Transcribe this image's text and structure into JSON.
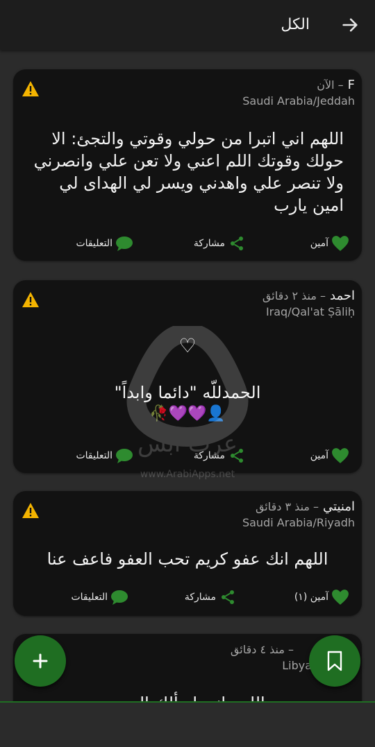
{
  "appbar": {
    "title": "الكل",
    "back_icon": "arrow-right-icon"
  },
  "posts": [
    {
      "author": "F",
      "time": "– الآن",
      "location": "Saudi Arabia/Jeddah",
      "text": "اللهم اني اتبرا من حولي وقوتي والتجئ: الا حولك وقوتك اللم اعني ولا تعن علي وانصرني ولا تنصر علي واهدني ويسر لي الهداى لي امين يارب",
      "amen_label": "آمين",
      "share_label": "مشاركة",
      "comments_label": "التعليقات"
    },
    {
      "author": "احمد",
      "time": "– منذ ٢ دقائق",
      "location": "Iraq/Qal'at Ṣāliḥ",
      "heart": "♡",
      "text": "الحمدللّه   \"دائما وابداً\"",
      "emoji": "👤💜💜🥀",
      "amen_label": "آمين",
      "share_label": "مشاركة",
      "comments_label": "التعليقات"
    },
    {
      "author": "امنيتي",
      "time": "– منذ ٣ دقائق",
      "location": "Saudi Arabia/Riyadh",
      "text": "اللهم انك عفو كريم تحب العفو فاعف عنا",
      "amen_label": "آمين (١)",
      "share_label": "مشاركة",
      "comments_label": "التعليقات"
    },
    {
      "author": "",
      "time": "– منذ ٤ دقائق",
      "location": "Libya",
      "text": "اللهم انى اسألك الهدى"
    }
  ],
  "fab_add": {
    "icon": "plus-icon"
  },
  "fab_bookmark": {
    "icon": "bookmark-icon"
  },
  "watermark": {
    "name": "عرب ابس",
    "url": "www.ArabiApps.net"
  },
  "colors": {
    "background": "#2b2b2b",
    "card": "#121212",
    "accent_green": "#1f6e22",
    "warning": "#f4b400"
  }
}
